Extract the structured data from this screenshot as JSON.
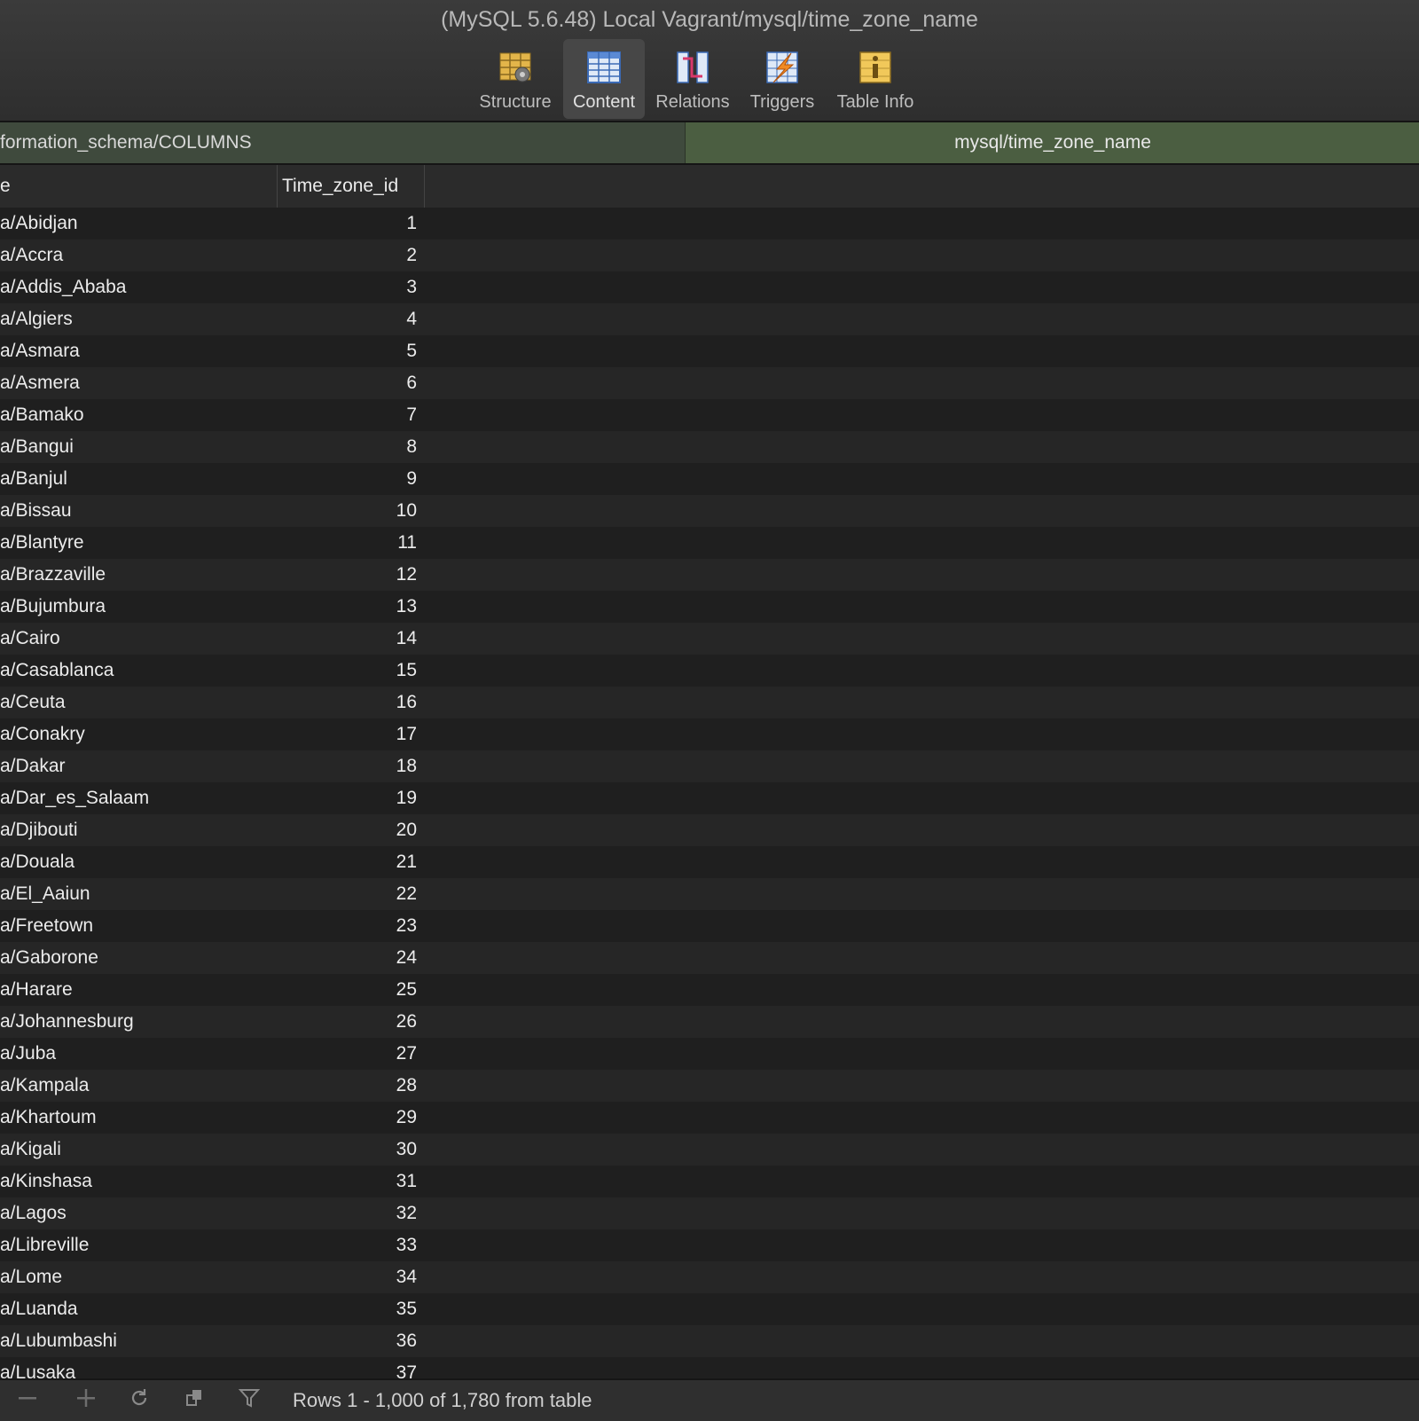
{
  "window": {
    "title": "(MySQL 5.6.48) Local Vagrant/mysql/time_zone_name"
  },
  "toolbar": {
    "items": [
      {
        "label": "Structure",
        "icon": "structure-icon",
        "active": false
      },
      {
        "label": "Content",
        "icon": "content-table-icon",
        "active": true
      },
      {
        "label": "Relations",
        "icon": "relations-icon",
        "active": false
      },
      {
        "label": "Triggers",
        "icon": "triggers-icon",
        "active": false
      },
      {
        "label": "Table Info",
        "icon": "table-info-icon",
        "active": false
      }
    ]
  },
  "tabs": [
    {
      "label": "formation_schema/COLUMNS",
      "active": false
    },
    {
      "label": "mysql/time_zone_name",
      "active": true
    }
  ],
  "table": {
    "columns": [
      "e",
      "Time_zone_id"
    ],
    "rows": [
      [
        "a/Abidjan",
        "1"
      ],
      [
        "a/Accra",
        "2"
      ],
      [
        "a/Addis_Ababa",
        "3"
      ],
      [
        "a/Algiers",
        "4"
      ],
      [
        "a/Asmara",
        "5"
      ],
      [
        "a/Asmera",
        "6"
      ],
      [
        "a/Bamako",
        "7"
      ],
      [
        "a/Bangui",
        "8"
      ],
      [
        "a/Banjul",
        "9"
      ],
      [
        "a/Bissau",
        "10"
      ],
      [
        "a/Blantyre",
        "11"
      ],
      [
        "a/Brazzaville",
        "12"
      ],
      [
        "a/Bujumbura",
        "13"
      ],
      [
        "a/Cairo",
        "14"
      ],
      [
        "a/Casablanca",
        "15"
      ],
      [
        "a/Ceuta",
        "16"
      ],
      [
        "a/Conakry",
        "17"
      ],
      [
        "a/Dakar",
        "18"
      ],
      [
        "a/Dar_es_Salaam",
        "19"
      ],
      [
        "a/Djibouti",
        "20"
      ],
      [
        "a/Douala",
        "21"
      ],
      [
        "a/El_Aaiun",
        "22"
      ],
      [
        "a/Freetown",
        "23"
      ],
      [
        "a/Gaborone",
        "24"
      ],
      [
        "a/Harare",
        "25"
      ],
      [
        "a/Johannesburg",
        "26"
      ],
      [
        "a/Juba",
        "27"
      ],
      [
        "a/Kampala",
        "28"
      ],
      [
        "a/Khartoum",
        "29"
      ],
      [
        "a/Kigali",
        "30"
      ],
      [
        "a/Kinshasa",
        "31"
      ],
      [
        "a/Lagos",
        "32"
      ],
      [
        "a/Libreville",
        "33"
      ],
      [
        "a/Lome",
        "34"
      ],
      [
        "a/Luanda",
        "35"
      ],
      [
        "a/Lubumbashi",
        "36"
      ],
      [
        "a/Lusaka",
        "37"
      ]
    ]
  },
  "statusbar": {
    "text": "Rows 1 - 1,000 of 1,780 from table",
    "buttons": [
      "remove-row-icon",
      "add-row-icon",
      "refresh-icon",
      "duplicate-icon",
      "filter-icon"
    ]
  }
}
